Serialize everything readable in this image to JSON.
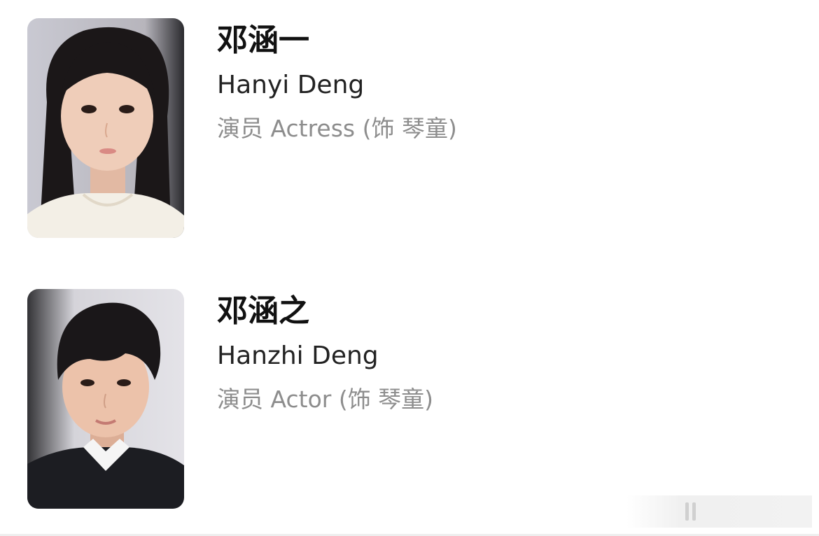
{
  "cast": [
    {
      "name_zh": "邓涵一",
      "name_en": "Hanyi Deng",
      "role": "演员 Actress (饰 琴童)",
      "photo_icon": "girl-portrait"
    },
    {
      "name_zh": "邓涵之",
      "name_en": "Hanzhi Deng",
      "role": "演员 Actor (饰 琴童)",
      "photo_icon": "boy-portrait"
    }
  ],
  "colors": {
    "name": "#111111",
    "subtitle": "#222222",
    "role": "#8d8d8d",
    "background": "#ffffff"
  }
}
